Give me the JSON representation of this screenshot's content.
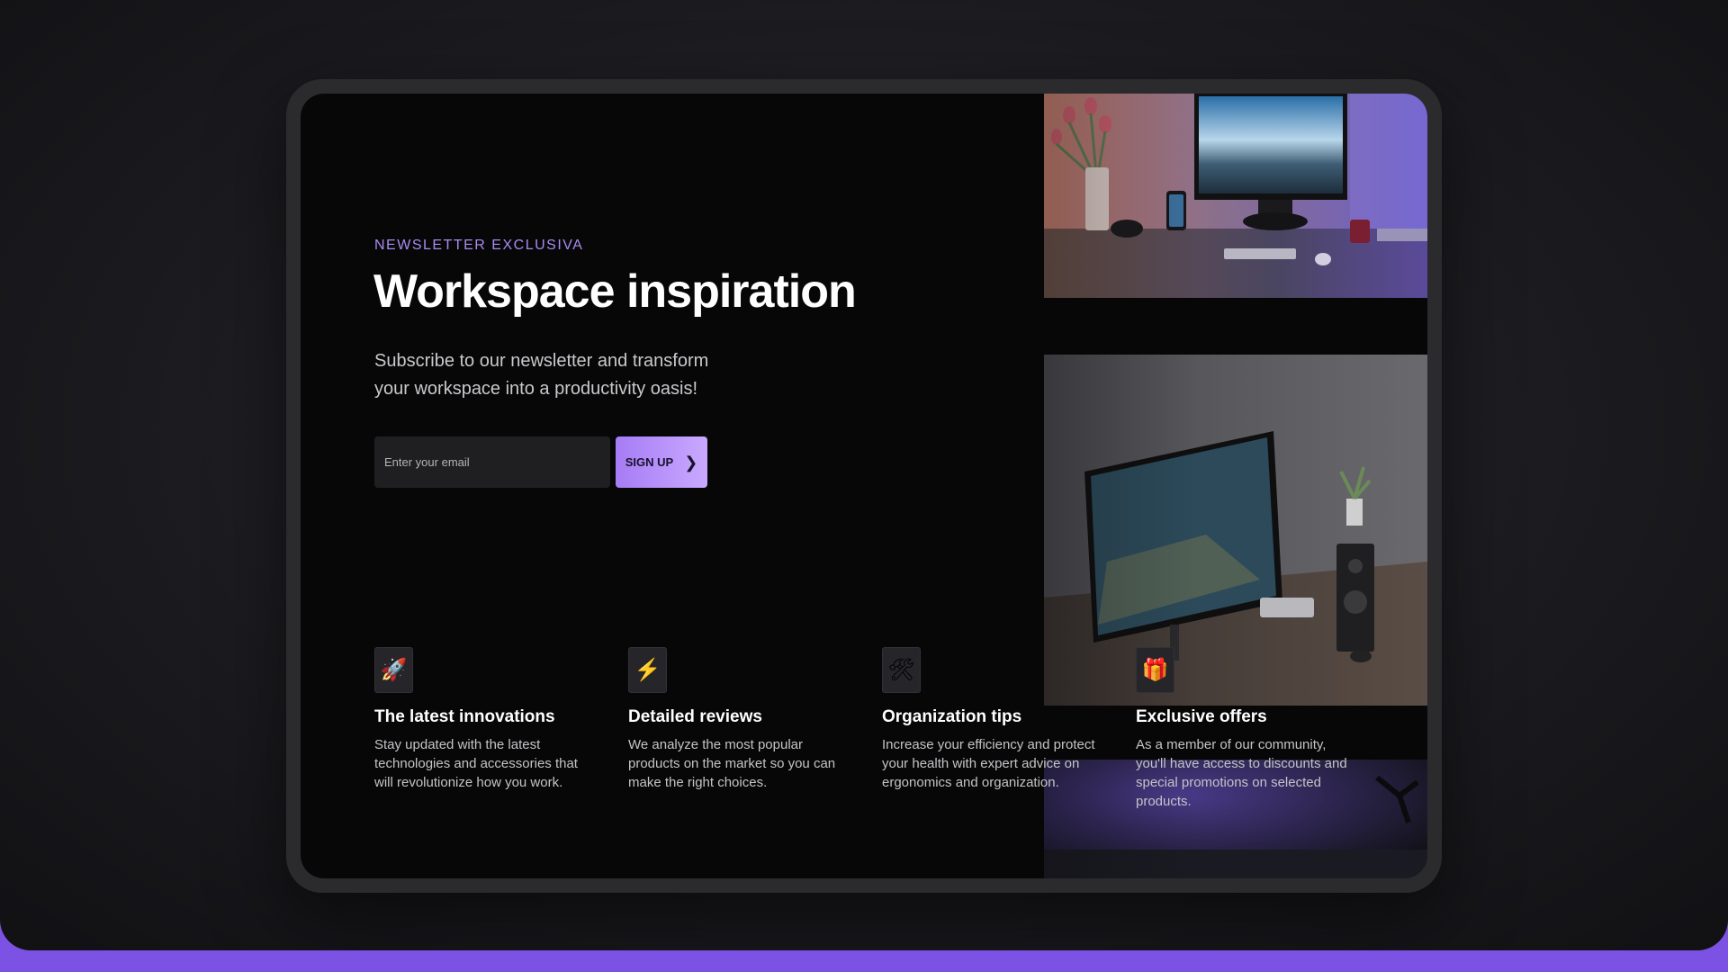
{
  "hero": {
    "eyebrow": "NEWSLETTER EXCLUSIVA",
    "title": "Workspace inspiration",
    "subtitle": "Subscribe to our newsletter and transform your workspace into a productivity oasis!"
  },
  "form": {
    "email_placeholder": "Enter your email",
    "email_value": "",
    "signup_label": "SIGN UP",
    "signup_icon": "chevron-right-icon"
  },
  "features": [
    {
      "icon": "rocket-icon",
      "glyph": "🚀",
      "title": "The latest innovations",
      "description": "Stay updated with the latest technologies and accessories that will revolutionize how you work."
    },
    {
      "icon": "lightning-icon",
      "glyph": "⚡",
      "title": "Detailed reviews",
      "description": "We analyze the most popular products on the market so you can make the right choices."
    },
    {
      "icon": "tools-icon",
      "glyph": "🛠",
      "title": "Organization tips",
      "description": "Increase your efficiency and protect your health with expert advice on ergonomics and organization."
    },
    {
      "icon": "gift-icon",
      "glyph": "🎁",
      "title": "Exclusive offers",
      "description": "As a member of our community, you'll have access to discounts and special promotions on selected products."
    }
  ],
  "colors": {
    "accent": "#a98bf0",
    "button_gradient_start": "#a67cf5",
    "button_gradient_end": "#c9a9ff",
    "bottom_bar": "#7b52e3",
    "screen_bg": "#070708"
  }
}
